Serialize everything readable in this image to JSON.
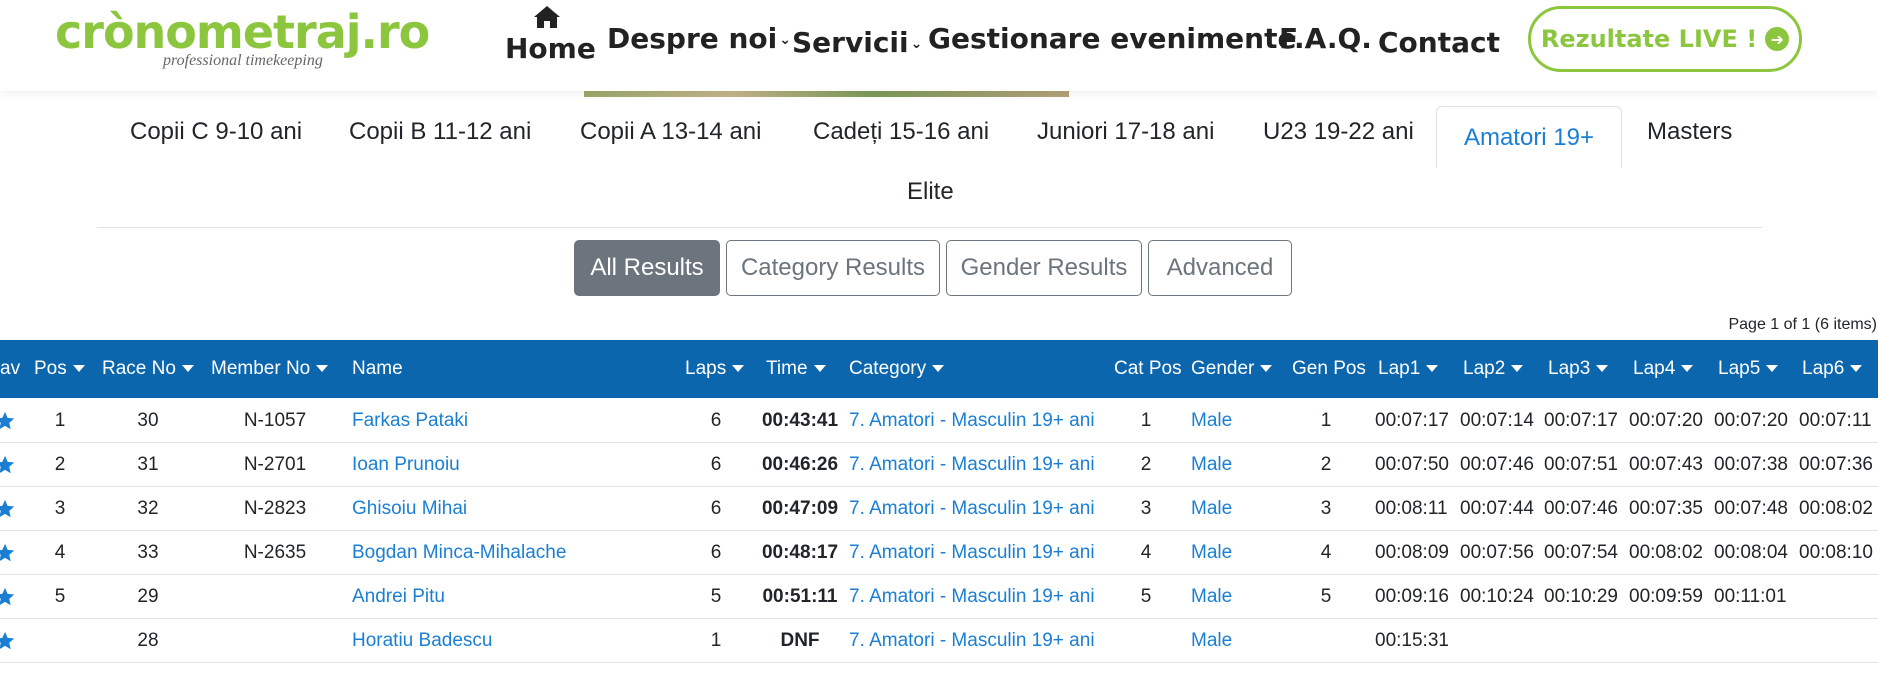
{
  "header": {
    "logo_text": "crònometraj.ro",
    "logo_tagline": "professional timekeeping",
    "nav": {
      "home": "Home",
      "despre": "Despre noi",
      "servicii": "Servicii",
      "gestionare": "Gestionare evenimente",
      "faq": "F.A.Q.",
      "contact": "Contact"
    },
    "live_button": "Rezultate LIVE !",
    "brand_color": "#8cc63f"
  },
  "tabs": {
    "copii_c": "Copii C 9-10 ani",
    "copii_b": "Copii B 11-12 ani",
    "copii_a": "Copii A 13-14 ani",
    "cadeti": "Cadeți 15-16 ani",
    "juniori": "Juniori 17-18 ani",
    "u23": "U23 19-22 ani",
    "amatori": "Amatori 19+",
    "masters": "Masters",
    "elite": "Elite",
    "active": "Amatori 19+"
  },
  "result_buttons": {
    "all": "All Results",
    "category": "Category Results",
    "gender": "Gender Results",
    "advanced": "Advanced"
  },
  "page_info": "Page 1 of 1 (6 items)",
  "table": {
    "header_color": "#0b66ad",
    "columns": {
      "fav": "av",
      "pos": "Pos",
      "race_no": "Race No",
      "member_no": "Member No",
      "name": "Name",
      "laps": "Laps",
      "time": "Time",
      "category": "Category",
      "cat_pos": "Cat Pos",
      "gender": "Gender",
      "gen_pos": "Gen Pos",
      "lap1": "Lap1",
      "lap2": "Lap2",
      "lap3": "Lap3",
      "lap4": "Lap4",
      "lap5": "Lap5",
      "lap6": "Lap6"
    },
    "rows": [
      {
        "pos": "1",
        "race_no": "30",
        "member_no": "N-1057",
        "name": "Farkas Pataki",
        "laps": "6",
        "time": "00:43:41",
        "category": "7. Amatori - Masculin 19+ ani",
        "cat_pos": "1",
        "gender": "Male",
        "gen_pos": "1",
        "lap1": "00:07:17",
        "lap2": "00:07:14",
        "lap3": "00:07:17",
        "lap4": "00:07:20",
        "lap5": "00:07:20",
        "lap6": "00:07:11"
      },
      {
        "pos": "2",
        "race_no": "31",
        "member_no": "N-2701",
        "name": "Ioan Prunoiu",
        "laps": "6",
        "time": "00:46:26",
        "category": "7. Amatori - Masculin 19+ ani",
        "cat_pos": "2",
        "gender": "Male",
        "gen_pos": "2",
        "lap1": "00:07:50",
        "lap2": "00:07:46",
        "lap3": "00:07:51",
        "lap4": "00:07:43",
        "lap5": "00:07:38",
        "lap6": "00:07:36"
      },
      {
        "pos": "3",
        "race_no": "32",
        "member_no": "N-2823",
        "name": "Ghisoiu Mihai",
        "laps": "6",
        "time": "00:47:09",
        "category": "7. Amatori - Masculin 19+ ani",
        "cat_pos": "3",
        "gender": "Male",
        "gen_pos": "3",
        "lap1": "00:08:11",
        "lap2": "00:07:44",
        "lap3": "00:07:46",
        "lap4": "00:07:35",
        "lap5": "00:07:48",
        "lap6": "00:08:02"
      },
      {
        "pos": "4",
        "race_no": "33",
        "member_no": "N-2635",
        "name": "Bogdan Minca-Mihalache",
        "laps": "6",
        "time": "00:48:17",
        "category": "7. Amatori - Masculin 19+ ani",
        "cat_pos": "4",
        "gender": "Male",
        "gen_pos": "4",
        "lap1": "00:08:09",
        "lap2": "00:07:56",
        "lap3": "00:07:54",
        "lap4": "00:08:02",
        "lap5": "00:08:04",
        "lap6": "00:08:10"
      },
      {
        "pos": "5",
        "race_no": "29",
        "member_no": "",
        "name": "Andrei Pitu",
        "laps": "5",
        "time": "00:51:11",
        "category": "7. Amatori - Masculin 19+ ani",
        "cat_pos": "5",
        "gender": "Male",
        "gen_pos": "5",
        "lap1": "00:09:16",
        "lap2": "00:10:24",
        "lap3": "00:10:29",
        "lap4": "00:09:59",
        "lap5": "00:11:01",
        "lap6": ""
      },
      {
        "pos": "",
        "race_no": "28",
        "member_no": "",
        "name": "Horatiu Badescu",
        "laps": "1",
        "time": "DNF",
        "category": "7. Amatori - Masculin 19+ ani",
        "cat_pos": "",
        "gender": "Male",
        "gen_pos": "",
        "lap1": "00:15:31",
        "lap2": "",
        "lap3": "",
        "lap4": "",
        "lap5": "",
        "lap6": ""
      }
    ]
  }
}
